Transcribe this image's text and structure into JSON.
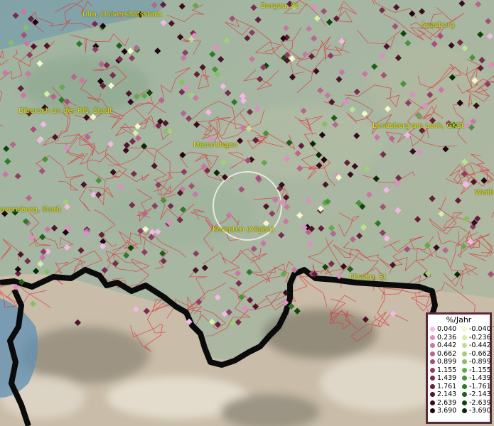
{
  "map": {
    "cities": [
      {
        "name": "Ulm, Universitätsstadt"
      },
      {
        "name": "Burgau, St"
      },
      {
        "name": "Augsburg"
      },
      {
        "name": "Biberach an der Riß, Stadt"
      },
      {
        "name": "Landsberg am Lech, GKSt"
      },
      {
        "name": "Memmingen"
      },
      {
        "name": "Weilh"
      },
      {
        "name": "avensburg, Stadt"
      },
      {
        "name": "Kempten (Allgäu)"
      },
      {
        "name": "Füssen, St"
      }
    ]
  },
  "legend": {
    "title": "%/Jahr",
    "positive": [
      {
        "label": "0.040",
        "color": "#f2b8e6"
      },
      {
        "label": "0.236",
        "color": "#dc8fc4"
      },
      {
        "label": "0.442",
        "color": "#c977a6"
      },
      {
        "label": "0.662",
        "color": "#b86590"
      },
      {
        "label": "0.899",
        "color": "#a4507a"
      },
      {
        "label": "1.155",
        "color": "#8e3d63"
      },
      {
        "label": "1.439",
        "color": "#782c4e"
      },
      {
        "label": "1.761",
        "color": "#641f3c"
      },
      {
        "label": "2.143",
        "color": "#4e152c"
      },
      {
        "label": "2.639",
        "color": "#380c1e"
      },
      {
        "label": "3.690",
        "color": "#1e0510"
      }
    ],
    "negative": [
      {
        "label": "-0.040",
        "color": "#f2f8c8"
      },
      {
        "label": "-0.236",
        "color": "#d6ecaa"
      },
      {
        "label": "-0.442",
        "color": "#bfe092"
      },
      {
        "label": "-0.662",
        "color": "#a2cf7a"
      },
      {
        "label": "-0.899",
        "color": "#86bf65"
      },
      {
        "label": "-1.155",
        "color": "#66a84e"
      },
      {
        "label": "-1.439",
        "color": "#4a923a"
      },
      {
        "label": "-1.761",
        "color": "#2e7a28"
      },
      {
        "label": "-2.143",
        "color": "#1d6018"
      },
      {
        "label": "-2.639",
        "color": "#0f460c"
      },
      {
        "label": "-3.690",
        "color": "#072a06"
      }
    ]
  }
}
